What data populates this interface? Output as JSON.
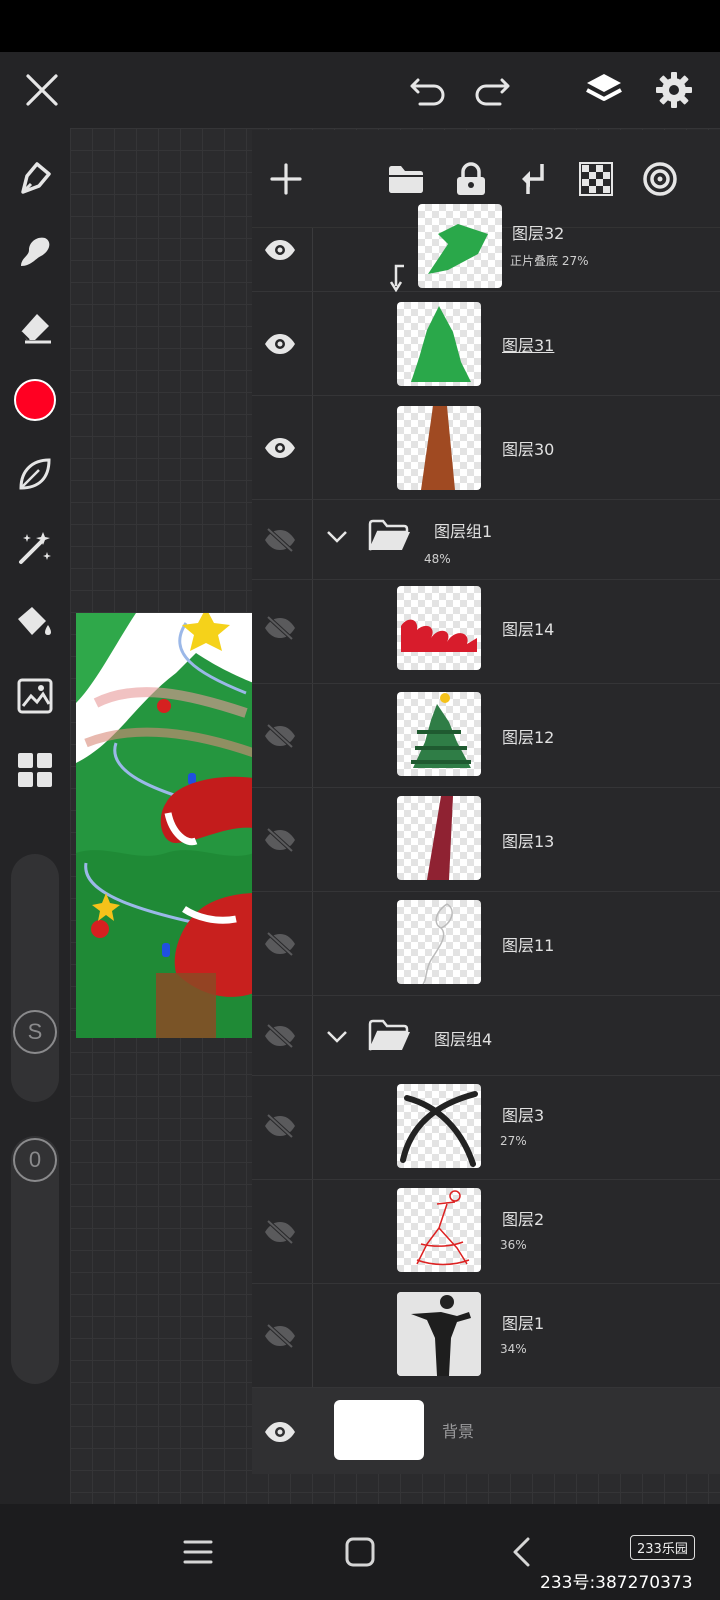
{
  "colors": {
    "current": "#ff0022",
    "accent": "#ffffff"
  },
  "sliders": {
    "size_label": "S",
    "opacity_label": "0"
  },
  "layers": [
    {
      "name": "图层32",
      "sub": "正片叠底   27%",
      "visible": true,
      "clip": true
    },
    {
      "name": "图层31",
      "sub": "",
      "visible": true
    },
    {
      "name": "图层30",
      "sub": "",
      "visible": true
    },
    {
      "group": true,
      "name": "图层组1",
      "sub": "48%",
      "visible": false
    },
    {
      "name": "图层14",
      "sub": "",
      "visible": false
    },
    {
      "name": "图层12",
      "sub": "",
      "visible": false
    },
    {
      "name": "图层13",
      "sub": "",
      "visible": false
    },
    {
      "name": "图层11",
      "sub": "",
      "visible": false
    },
    {
      "group": true,
      "name": "图层组4",
      "sub": "",
      "visible": false
    },
    {
      "name": "图层3",
      "sub": "27%",
      "visible": false
    },
    {
      "name": "图层2",
      "sub": "36%",
      "visible": false
    },
    {
      "name": "图层1",
      "sub": "34%",
      "visible": false
    },
    {
      "background": true,
      "name": "背景",
      "visible": true
    }
  ],
  "watermark": {
    "brand": "233乐园",
    "id_text": "233号:387270373"
  }
}
